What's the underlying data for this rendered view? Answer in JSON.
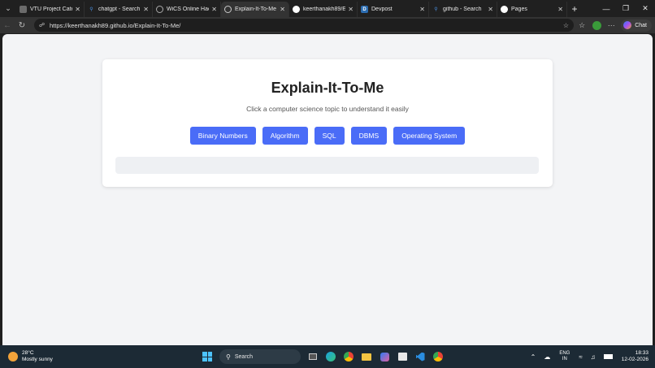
{
  "browser": {
    "tabs": [
      {
        "label": "VTU Project Categ",
        "icon": "page-icon",
        "color": "#8a8a8a",
        "active": false
      },
      {
        "label": "chatgpt - Search",
        "icon": "search-icon",
        "color": "#4a90e2",
        "active": false
      },
      {
        "label": "WiCS Online Hacka",
        "icon": "globe-icon",
        "color": "#8a8a8a",
        "active": false
      },
      {
        "label": "Explain-It-To-Me",
        "icon": "globe-icon",
        "color": "#8a8a8a",
        "active": true
      },
      {
        "label": "keerthanakh89/Exp",
        "icon": "github-icon",
        "color": "#ffffff",
        "active": false
      },
      {
        "label": "Devpost",
        "icon": "devpost-icon",
        "color": "#2b6cb0",
        "active": false
      },
      {
        "label": "github - Search",
        "icon": "search-icon",
        "color": "#4a90e2",
        "active": false
      },
      {
        "label": "Pages",
        "icon": "github-icon",
        "color": "#ffffff",
        "active": false
      }
    ],
    "url": "https://keerthanakh89.github.io/Explain-It-To-Me/",
    "copilot_label": "Chat"
  },
  "page": {
    "title": "Explain-It-To-Me",
    "subtitle": "Click a computer science topic to understand it easily",
    "topics": [
      "Binary Numbers",
      "Algorithm",
      "SQL",
      "DBMS",
      "Operating System"
    ],
    "accent_color": "#4a6cf7",
    "output": ""
  },
  "taskbar": {
    "weather_temp": "28°C",
    "weather_desc": "Mostly sunny",
    "search_placeholder": "Search",
    "lang_line1": "ENG",
    "lang_line2": "IN",
    "time": "18:33",
    "date": "12-02-2026"
  }
}
